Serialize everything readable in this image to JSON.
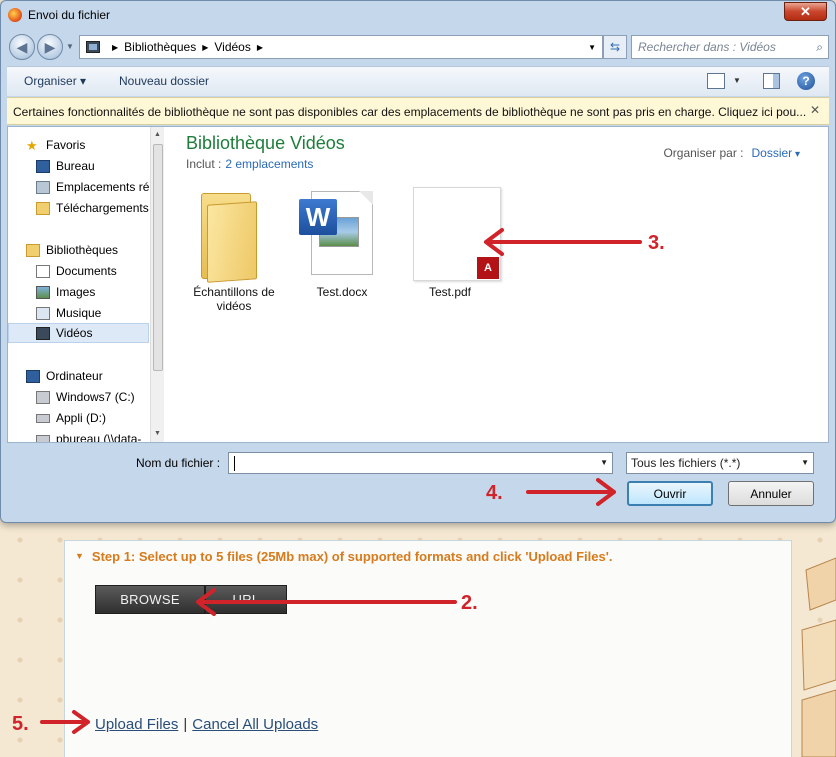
{
  "dialog": {
    "title": "Envoi du fichier",
    "close_label": "✕",
    "breadcrumb": [
      "Bibliothèques",
      "Vidéos"
    ],
    "search_placeholder": "Rechercher dans : Vidéos",
    "toolbar": {
      "organiser": "Organiser",
      "nouveau_dossier": "Nouveau dossier",
      "help": "?"
    },
    "infobar": "Certaines fonctionnalités de bibliothèque ne sont pas disponibles car des emplacements de bibliothèque ne sont pas pris en charge. Cliquez ici pou...",
    "nav": {
      "favoris": "Favoris",
      "bureau": "Bureau",
      "emplacements": "Emplacements ré",
      "telechargements": "Téléchargements",
      "bibliotheques": "Bibliothèques",
      "documents": "Documents",
      "images": "Images",
      "musique": "Musique",
      "videos": "Vidéos",
      "ordinateur": "Ordinateur",
      "windows7": "Windows7 (C:)",
      "appli": "Appli (D:)",
      "pbureau": "pbureau (\\\\data-"
    },
    "library": {
      "title": "Bibliothèque Vidéos",
      "inclut_label": "Inclut :",
      "inclut_link": "2 emplacements",
      "arrange_label": "Organiser par :",
      "arrange_value": "Dossier"
    },
    "files": [
      {
        "name": "Échantillons de vidéos",
        "type": "folder"
      },
      {
        "name": "Test.docx",
        "type": "docx"
      },
      {
        "name": "Test.pdf",
        "type": "pdf"
      }
    ],
    "filename_label": "Nom du fichier :",
    "filename_value": "",
    "filter_value": "Tous les fichiers (*.*)",
    "open_label": "Ouvrir",
    "cancel_label": "Annuler"
  },
  "upload": {
    "step_title": "Step 1: Select up to 5 files (25Mb max) of supported formats and click 'Upload Files'.",
    "browse_label": "BROWSE",
    "url_label": "URL",
    "upload_files_link": "Upload Files",
    "separator": "|",
    "cancel_all_link": "Cancel All Uploads"
  },
  "annotations": [
    "2.",
    "3.",
    "4.",
    "5."
  ],
  "colors": {
    "annotation_red": "#d0232a",
    "step_orange": "#d77b1c",
    "library_green": "#1e7d3b"
  }
}
